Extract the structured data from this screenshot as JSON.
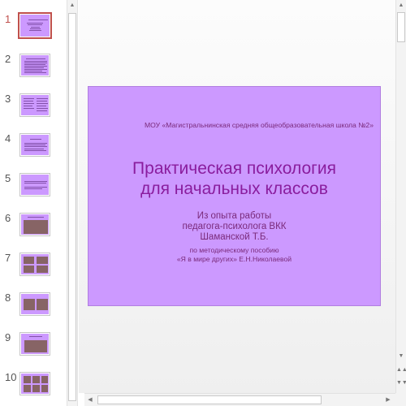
{
  "thumbnails": {
    "numbers": [
      "1",
      "2",
      "3",
      "4",
      "5",
      "6",
      "7",
      "8",
      "9",
      "10"
    ],
    "selected_index": 1
  },
  "slide": {
    "school": "МОУ «Магистральнинская средняя общеобразовательная школа №2»",
    "title_line1": "Практическая психология",
    "title_line2": "для начальных классов",
    "sub1": "Из опыта работы",
    "sub2": "педагога-психолога ВКК",
    "sub3": "Шаманской Т.Б.",
    "sub4": "по методическому пособию",
    "sub5": "«Я в мире других» Е.Н.Николаевой"
  },
  "colors": {
    "slide_background": "#cc99ff",
    "title_text": "#8a1d9e",
    "body_text": "#7a2a7a",
    "selection_border": "#c0504d"
  },
  "icons": {
    "scroll_up": "▲",
    "scroll_down": "▼",
    "scroll_left": "◀",
    "scroll_right": "▶",
    "prev_slide": "▲▲",
    "next_slide": "▼▼"
  }
}
